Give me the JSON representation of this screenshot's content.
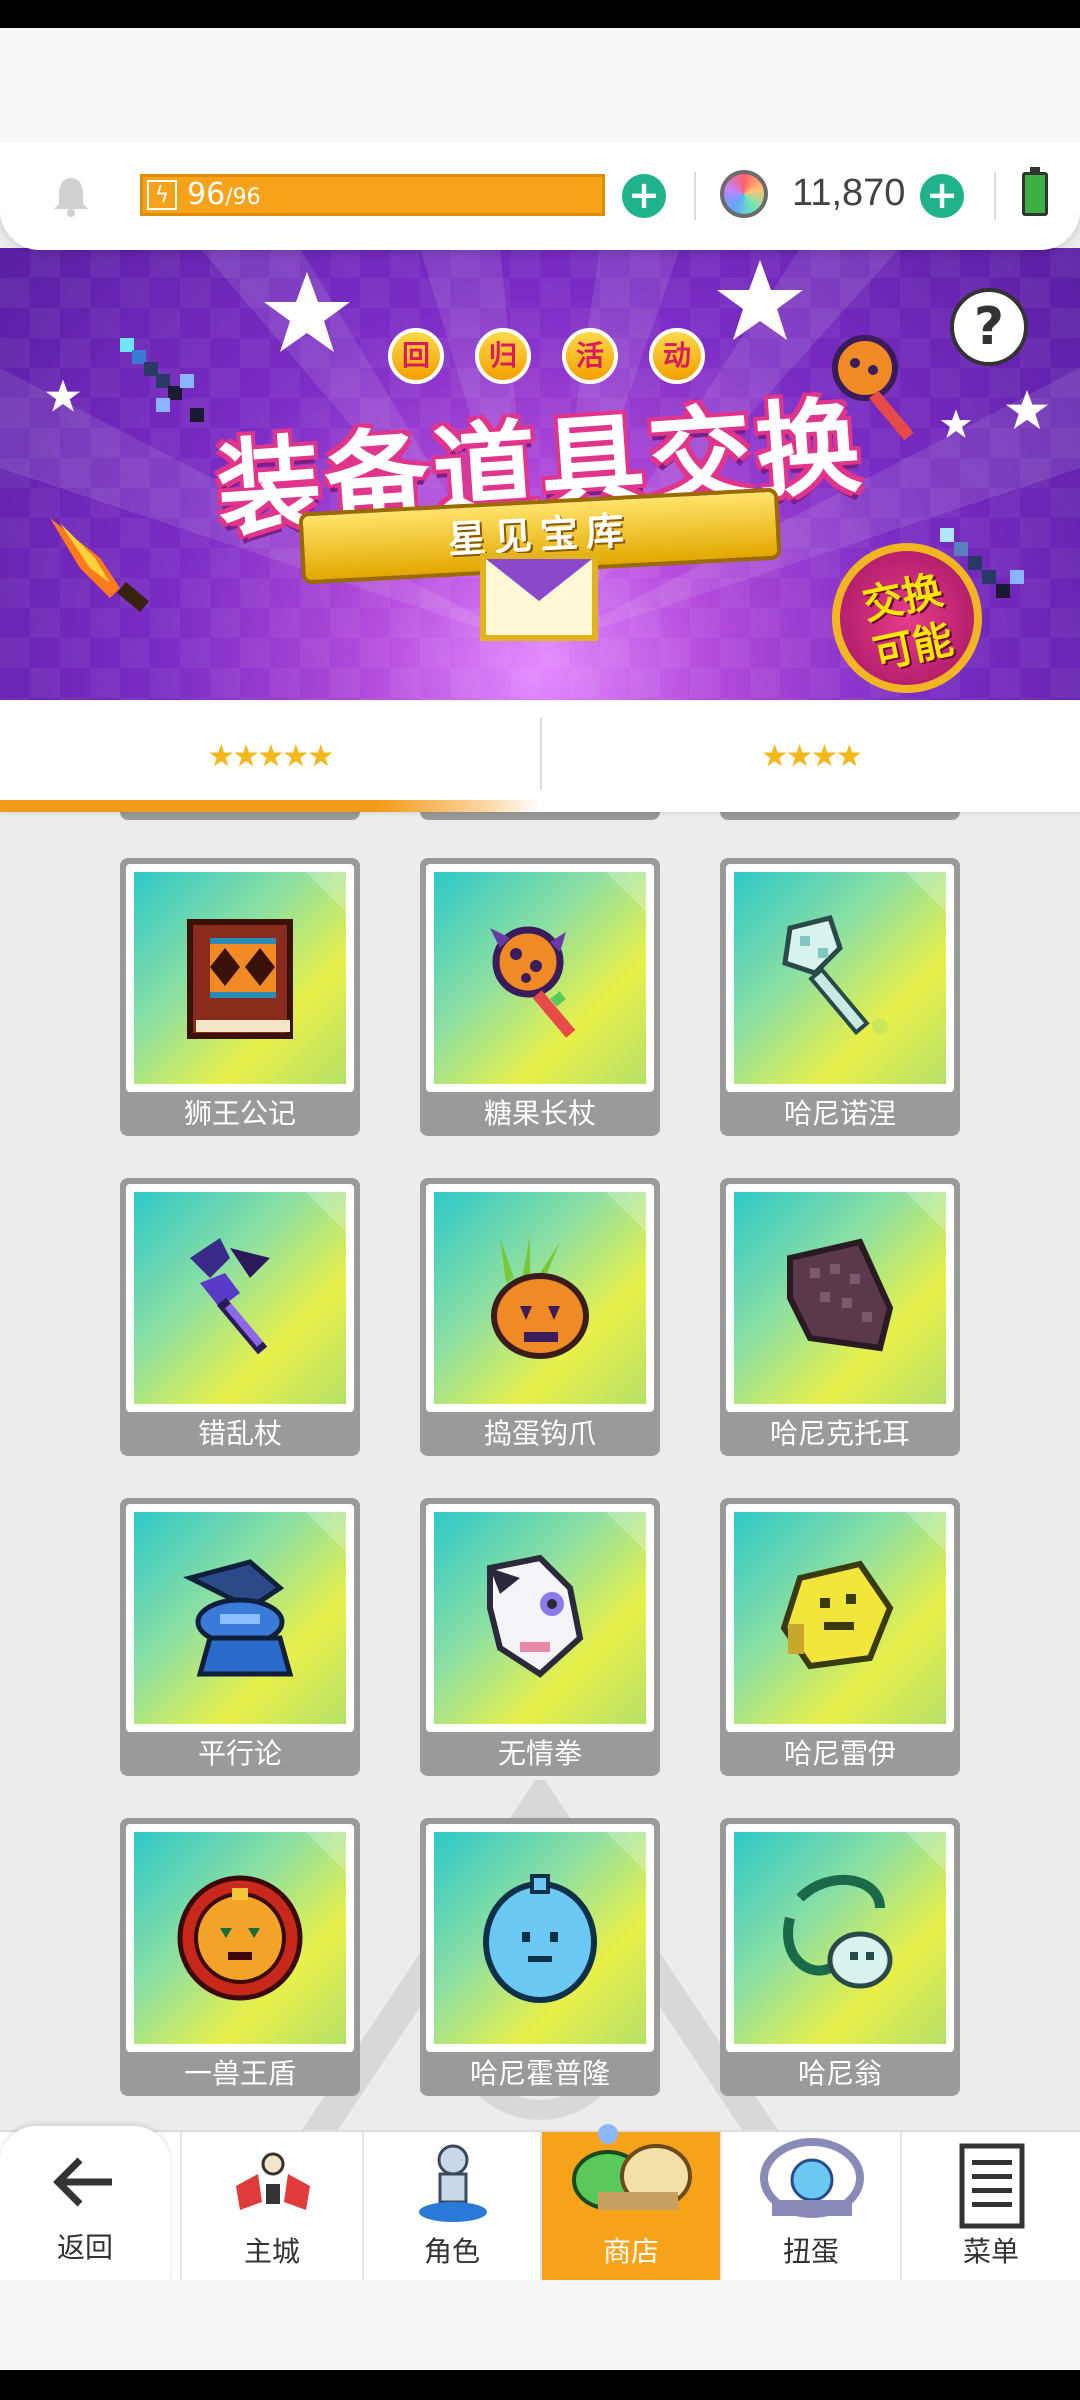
{
  "statusbar": {
    "energy_current": "96",
    "energy_max": "/96",
    "energy_percent": 100,
    "gems": "11,870"
  },
  "banner": {
    "badge_chars": [
      "回",
      "归",
      "活",
      "动"
    ],
    "title": "装备道具交换",
    "subtitle": "星见宝库",
    "exchange_badge_line1": "交换",
    "exchange_badge_line2": "可能",
    "help_symbol": "?"
  },
  "tabs": [
    {
      "stars": "★★★★★",
      "rating": 5,
      "active": true
    },
    {
      "stars": "★★★★",
      "rating": 4,
      "active": false
    }
  ],
  "items": [
    {
      "name": "狮王公记",
      "icon": "book-icon"
    },
    {
      "name": "糖果长杖",
      "icon": "candy-staff-icon"
    },
    {
      "name": "哈尼诺涅",
      "icon": "ice-staff-icon"
    },
    {
      "name": "错乱杖",
      "icon": "dark-staff-icon"
    },
    {
      "name": "捣蛋钩爪",
      "icon": "pumpkin-claw-icon"
    },
    {
      "name": "哈尼克托耳",
      "icon": "gauntlet-icon"
    },
    {
      "name": "平行论",
      "icon": "blue-gauntlet-icon"
    },
    {
      "name": "无情拳",
      "icon": "white-fist-icon"
    },
    {
      "name": "哈尼雷伊",
      "icon": "yellow-gauntlet-icon"
    },
    {
      "name": "一兽王盾",
      "icon": "lion-shield-icon"
    },
    {
      "name": "哈尼霍普隆",
      "icon": "blue-shield-icon"
    },
    {
      "name": "哈尼翁",
      "icon": "vine-staff-icon"
    }
  ],
  "nav": {
    "back": "返回",
    "items": [
      {
        "label": "主城",
        "icon": "castle-icon"
      },
      {
        "label": "角色",
        "icon": "character-icon"
      },
      {
        "label": "商店",
        "icon": "shop-icon",
        "active": true
      },
      {
        "label": "扭蛋",
        "icon": "gacha-icon"
      },
      {
        "label": "菜单",
        "icon": "menu-icon"
      }
    ]
  },
  "colors": {
    "accent_orange": "#f7a21b",
    "plus_green": "#20b38b",
    "card_gray": "#9a9a9a",
    "banner_purple": "#7a2cc4"
  }
}
